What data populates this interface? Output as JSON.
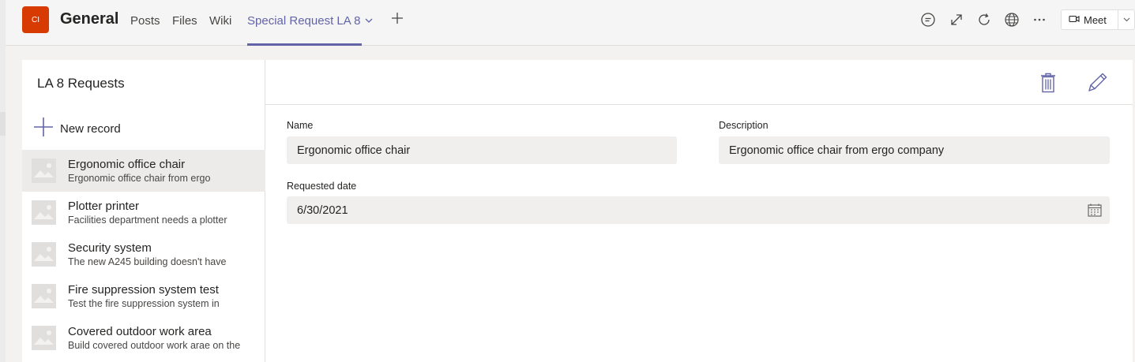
{
  "header": {
    "team_initials": "CI",
    "channel_name": "General",
    "tabs": [
      {
        "label": "Posts"
      },
      {
        "label": "Files"
      },
      {
        "label": "Wiki"
      }
    ],
    "active_tab": "Special Request LA 8",
    "add_tab_icon": "plus-icon",
    "toolbar_icons": [
      "conversation-icon",
      "expand-icon",
      "refresh-icon",
      "globe-icon",
      "more-icon"
    ],
    "meet_label": "Meet"
  },
  "list_panel": {
    "title": "LA 8 Requests",
    "new_record_label": "New record",
    "items": [
      {
        "title": "Ergonomic office chair",
        "subtitle": "Ergonomic office chair from ergo",
        "selected": true
      },
      {
        "title": "Plotter printer",
        "subtitle": "Facilities department needs a plotter",
        "selected": false
      },
      {
        "title": "Security system",
        "subtitle": "The new A245 building doesn't have",
        "selected": false
      },
      {
        "title": "Fire suppression system test",
        "subtitle": "Test the fire suppression system in",
        "selected": false
      },
      {
        "title": "Covered outdoor work area",
        "subtitle": "Build covered outdoor work arae on the",
        "selected": false
      }
    ]
  },
  "detail": {
    "actions": [
      "delete-icon",
      "edit-icon"
    ],
    "name_label": "Name",
    "name_value": "Ergonomic office chair",
    "description_label": "Description",
    "description_value": "Ergonomic office chair from ergo company",
    "date_label": "Requested date",
    "date_value": "6/30/2021"
  },
  "colors": {
    "accent": "#6264a7",
    "team_avatar": "#d83b01",
    "field_bg": "#f0efed",
    "selected_row": "#edebe9"
  }
}
